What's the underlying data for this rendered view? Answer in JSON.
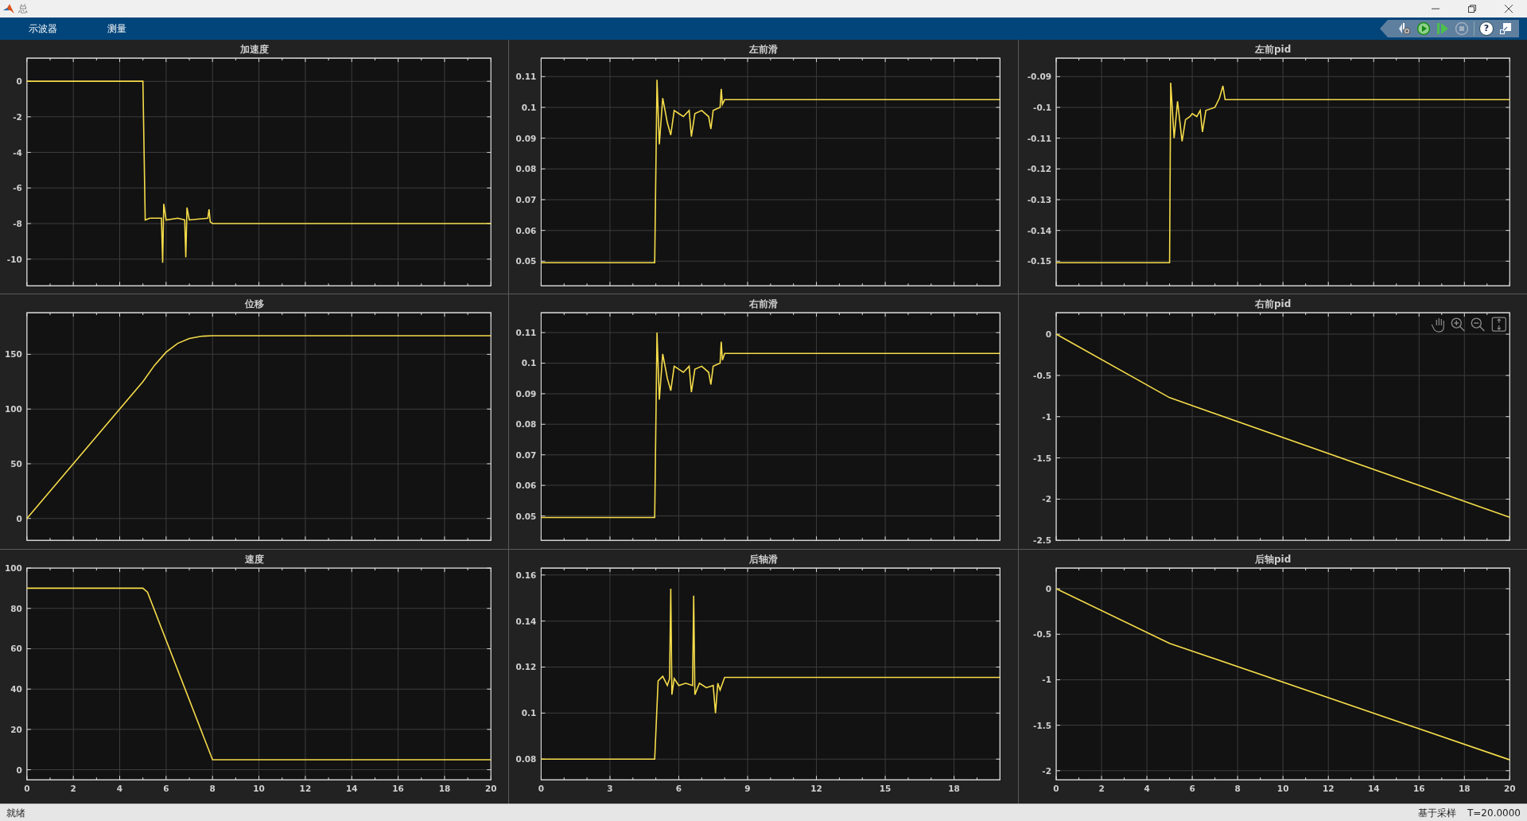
{
  "window": {
    "title": "总"
  },
  "tabs": [
    {
      "label": "示波器"
    },
    {
      "label": "测量"
    }
  ],
  "toolbar": [
    {
      "kind": "settings",
      "disabled": false
    },
    {
      "kind": "run",
      "disabled": false
    },
    {
      "kind": "step",
      "disabled": false
    },
    {
      "kind": "stop",
      "disabled": true
    },
    {
      "kind": "help",
      "label": "?",
      "disabled": false
    },
    {
      "kind": "undock",
      "disabled": false
    }
  ],
  "plots": [
    {
      "chart_data": {
        "type": "line",
        "title": "加速度",
        "grid": true,
        "x": [
          0,
          5,
          5.1,
          5.3,
          5.8,
          5.85,
          5.9,
          6.0,
          6.5,
          6.8,
          6.85,
          6.9,
          7.0,
          7.8,
          7.85,
          7.9,
          8.0,
          20
        ],
        "series": [
          {
            "color": "#f5dc4a",
            "values": [
              0,
              0,
              -7.8,
              -7.7,
              -7.7,
              -10.2,
              -6.9,
              -7.8,
              -7.7,
              -7.8,
              -9.9,
              -7.1,
              -7.8,
              -7.7,
              -7.2,
              -7.9,
              -8,
              -8
            ]
          }
        ],
        "xlim": [
          0,
          20
        ],
        "ylim": [
          -11.5,
          1.3
        ],
        "yticks": [
          -10,
          -8,
          -6,
          -4,
          -2,
          0
        ]
      }
    },
    {
      "chart_data": {
        "type": "line",
        "title": "左前滑",
        "grid": true,
        "x": [
          0,
          4.95,
          5.05,
          5.15,
          5.3,
          5.5,
          5.65,
          5.8,
          6,
          6.2,
          6.45,
          6.55,
          6.7,
          7.0,
          7.3,
          7.4,
          7.5,
          7.8,
          7.85,
          7.9,
          8.0,
          20
        ],
        "series": [
          {
            "color": "#f5dc4a",
            "values": [
              0.0495,
              0.0495,
              0.109,
              0.088,
              0.103,
              0.095,
              0.091,
              0.099,
              0.098,
              0.097,
              0.099,
              0.0905,
              0.098,
              0.099,
              0.097,
              0.093,
              0.099,
              0.1,
              0.106,
              0.101,
              0.1025,
              0.1025
            ]
          }
        ],
        "xlim": [
          0,
          20
        ],
        "ylim": [
          0.042,
          0.116
        ],
        "yticks": [
          0.05,
          0.06,
          0.07,
          0.08,
          0.09,
          0.1,
          0.11
        ]
      }
    },
    {
      "chart_data": {
        "type": "line",
        "title": "左前pid",
        "grid": true,
        "x": [
          0,
          5,
          5.05,
          5.2,
          5.35,
          5.55,
          5.7,
          5.9,
          6.0,
          6.2,
          6.35,
          6.45,
          6.6,
          7.0,
          7.2,
          7.35,
          7.45,
          20
        ],
        "series": [
          {
            "color": "#f5dc4a",
            "values": [
              -0.1505,
              -0.1505,
              -0.092,
              -0.11,
              -0.098,
              -0.111,
              -0.104,
              -0.103,
              -0.102,
              -0.103,
              -0.101,
              -0.108,
              -0.101,
              -0.1,
              -0.097,
              -0.093,
              -0.0975,
              -0.0975
            ]
          }
        ],
        "xlim": [
          0,
          20
        ],
        "ylim": [
          -0.158,
          -0.084
        ],
        "yticks": [
          -0.15,
          -0.14,
          -0.13,
          -0.12,
          -0.11,
          -0.1,
          -0.09
        ]
      }
    },
    {
      "chart_data": {
        "type": "line",
        "title": "位移",
        "grid": true,
        "x": [
          0,
          5,
          5.5,
          6,
          6.5,
          7,
          7.5,
          8,
          20
        ],
        "series": [
          {
            "color": "#f5dc4a",
            "values": [
              0,
              125,
              140,
              152,
              160,
              164.5,
              166.5,
              167,
              167
            ]
          }
        ],
        "xlim": [
          0,
          20
        ],
        "ylim": [
          -20,
          188
        ],
        "yticks": [
          0,
          50,
          100,
          150
        ]
      }
    },
    {
      "chart_data": {
        "type": "line",
        "title": "右前滑",
        "grid": true,
        "x": [
          0,
          4.95,
          5.05,
          5.15,
          5.3,
          5.5,
          5.65,
          5.8,
          6,
          6.2,
          6.45,
          6.55,
          6.7,
          7.0,
          7.3,
          7.4,
          7.5,
          7.8,
          7.85,
          7.9,
          8.0,
          20
        ],
        "series": [
          {
            "color": "#f5dc4a",
            "values": [
              0.0495,
              0.0495,
              0.11,
              0.088,
              0.103,
              0.095,
              0.091,
              0.099,
              0.098,
              0.097,
              0.099,
              0.0905,
              0.098,
              0.099,
              0.097,
              0.093,
              0.099,
              0.1,
              0.107,
              0.101,
              0.1032,
              0.1032
            ]
          }
        ],
        "xlim": [
          0,
          20
        ],
        "ylim": [
          0.042,
          0.1165
        ],
        "yticks": [
          0.05,
          0.06,
          0.07,
          0.08,
          0.09,
          0.1,
          0.11
        ]
      }
    },
    {
      "axes_toolbar": true,
      "chart_data": {
        "type": "line",
        "title": "右前pid",
        "grid": true,
        "x": [
          0,
          5,
          20
        ],
        "series": [
          {
            "color": "#f5dc4a",
            "values": [
              0,
              -0.77,
              -2.22
            ]
          }
        ],
        "xlim": [
          0,
          20
        ],
        "ylim": [
          -2.5,
          0.26
        ],
        "yticks": [
          -2.5,
          -2,
          -1.5,
          -1,
          -0.5,
          0
        ]
      }
    },
    {
      "chart_data": {
        "type": "line",
        "title": "速度",
        "grid": true,
        "x": [
          0,
          5,
          5.2,
          8,
          20
        ],
        "series": [
          {
            "color": "#f5dc4a",
            "values": [
              90,
              90,
              88,
              5,
              5
            ]
          }
        ],
        "xlim": [
          0,
          20
        ],
        "ylim": [
          -5,
          100
        ],
        "xticks": [
          0,
          2,
          4,
          6,
          8,
          10,
          12,
          14,
          16,
          18,
          20
        ],
        "yticks": [
          0,
          20,
          40,
          60,
          80,
          100
        ]
      }
    },
    {
      "chart_data": {
        "type": "line",
        "title": "后轴滑",
        "grid": true,
        "x": [
          0,
          4.95,
          5.1,
          5.3,
          5.5,
          5.6,
          5.65,
          5.7,
          5.8,
          6,
          6.3,
          6.6,
          6.65,
          6.7,
          6.9,
          7.2,
          7.5,
          7.6,
          7.7,
          7.8,
          8,
          20
        ],
        "series": [
          {
            "color": "#f5dc4a",
            "values": [
              0.08,
              0.08,
              0.114,
              0.116,
              0.112,
              0.115,
              0.154,
              0.108,
              0.115,
              0.112,
              0.113,
              0.112,
              0.151,
              0.108,
              0.113,
              0.111,
              0.112,
              0.1,
              0.113,
              0.11,
              0.1155,
              0.1155
            ]
          }
        ],
        "xlim": [
          0,
          20
        ],
        "ylim": [
          0.071,
          0.163
        ],
        "xticks": [
          0,
          3,
          6,
          9,
          12,
          15,
          18
        ],
        "yticks": [
          0.08,
          0.1,
          0.12,
          0.14,
          0.16
        ]
      }
    },
    {
      "chart_data": {
        "type": "line",
        "title": "后轴pid",
        "grid": true,
        "x": [
          0,
          5,
          20
        ],
        "series": [
          {
            "color": "#f5dc4a",
            "values": [
              0,
              -0.6,
              -1.88
            ]
          }
        ],
        "xlim": [
          0,
          20
        ],
        "ylim": [
          -2.1,
          0.227
        ],
        "xticks": [
          0,
          2,
          4,
          6,
          8,
          10,
          12,
          14,
          16,
          18,
          20
        ],
        "yticks": [
          -2,
          -1.5,
          -1,
          -0.5,
          0
        ]
      }
    }
  ],
  "status_bar": {
    "state": "就绪",
    "mode": "基于采样",
    "time": "T=20.0000"
  }
}
